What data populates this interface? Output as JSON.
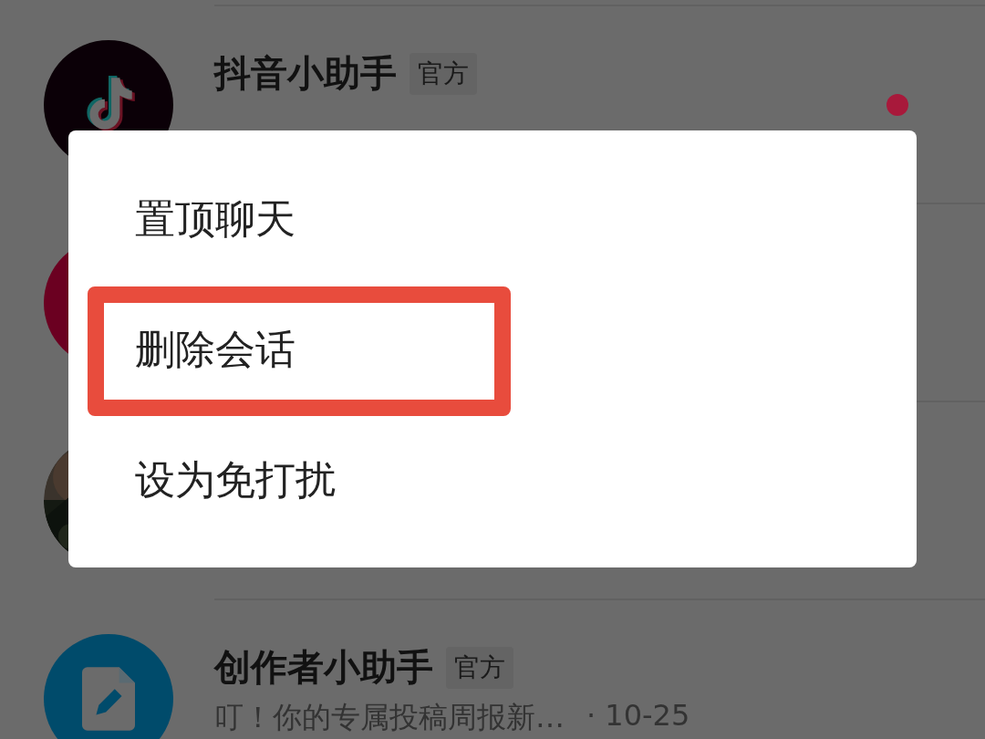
{
  "conversations": [
    {
      "avatar": {
        "kind": "logo",
        "color": "#0b0007"
      },
      "name": "抖音小助手",
      "badge": "官方",
      "unread": true
    },
    {
      "avatar": {
        "kind": "plain",
        "color": "#6b0021"
      }
    },
    {
      "avatar": {
        "kind": "picture"
      }
    },
    {
      "avatar": {
        "kind": "document",
        "color": "#004b6b"
      },
      "name": "创作者小助手",
      "badge": "官方",
      "preview": "叮！你的专属投稿周报新…",
      "time": "· 10-25",
      "unread": false
    }
  ],
  "menu": {
    "items": [
      {
        "label": "置顶聊天",
        "highlighted": false
      },
      {
        "label": "删除会话",
        "highlighted": true
      },
      {
        "label": "设为免打扰",
        "highlighted": false
      }
    ]
  }
}
